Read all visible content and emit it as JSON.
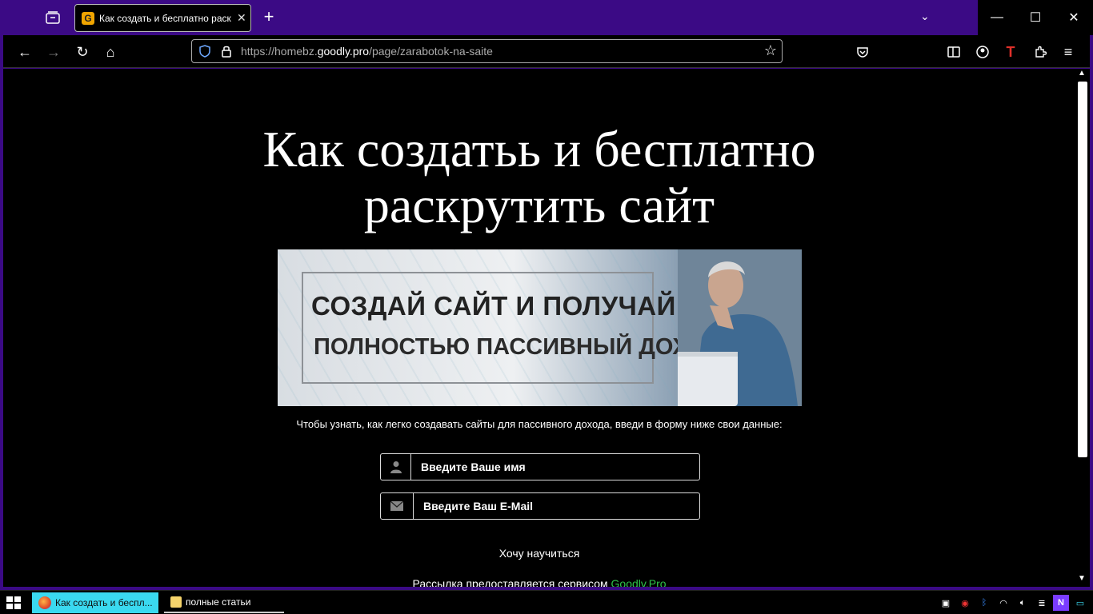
{
  "browser": {
    "tab_title": "Как создать и бесплатно раск",
    "tab_favicon_letter": "G",
    "url_prefix": "https://homebz.",
    "url_domain": "goodly.pro",
    "url_path": "/page/zarabotok-na-saite"
  },
  "page": {
    "headline_line1": "Как создатьь и бесплатно",
    "headline_line2": "раскрутить сайт",
    "banner_line1": "СОЗДАЙ САЙТ И ПОЛУЧАЙ",
    "banner_line2": "ПОЛНОСТЬЮ ПАССИВНЫЙ ДОХОД",
    "intro_text": "Чтобы узнать, как легко создавать сайты для пассивного дохода, введи в форму ниже свои данные:",
    "name_placeholder": "Введите Ваше имя",
    "email_placeholder": "Введите Ваш E-Mail",
    "submit_label": "Хочу научиться",
    "footer_text": "Рассылка предоставляется сервисом ",
    "footer_link": "Goodly.Pro"
  },
  "taskbar": {
    "task1_label": "Как создать и беспл...",
    "task2_label": "полные статьи"
  },
  "colors": {
    "titlebar": "#3b0a85",
    "link_green": "#2ec44a",
    "task_active": "#3ad9f0"
  }
}
